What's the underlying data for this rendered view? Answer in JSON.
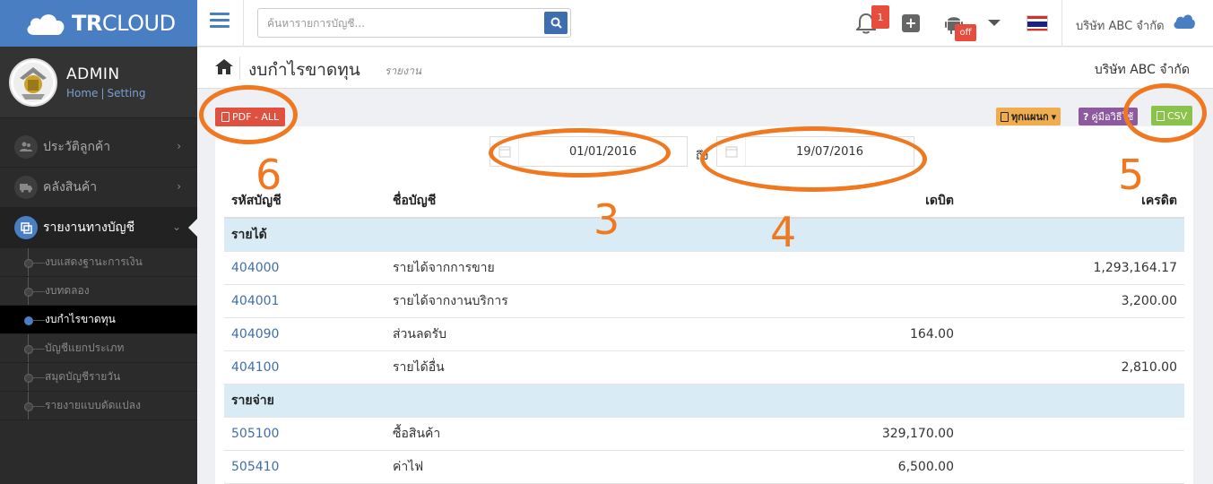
{
  "brand": {
    "name_bold": "TR",
    "name_rest": "CLOUD"
  },
  "user": {
    "name": "ADMIN",
    "link_home": "Home",
    "link_sep": "|",
    "link_setting": "Setting"
  },
  "nav": [
    {
      "label": "ประวัติลูกค้า",
      "icon": "users-icon"
    },
    {
      "label": "คลังสินค้า",
      "icon": "truck-icon"
    },
    {
      "label": "รายงานทางบัญชี",
      "icon": "report-icon"
    }
  ],
  "subnav": [
    {
      "label": "งบแสดงฐานะการเงิน"
    },
    {
      "label": "งบทดลอง"
    },
    {
      "label": "งบกำไรขาดทุน"
    },
    {
      "label": "บัญชีแยกประเภท"
    },
    {
      "label": "สมุดบัญชีรายวัน"
    },
    {
      "label": "รายงายแบบดัดแปลง"
    }
  ],
  "topbar": {
    "search_placeholder": "ค้นหารายการบัญชี...",
    "notification_count": "1",
    "android_badge": "off",
    "company": "บริษัท ABC จำกัด"
  },
  "page": {
    "title": "งบกำไรขาดทุน",
    "subtitle": "รายงาน",
    "company": "บริษัท ABC จำกัด"
  },
  "toolbar": {
    "pdf_label": "PDF - ALL",
    "plan_label": "ทุกแผนก",
    "manual_label": "คู่มือวิธีใช้",
    "csv_label": "CSV"
  },
  "filter": {
    "date_from": "01/01/2016",
    "to_label": "ถึง",
    "date_to": "19/07/2016"
  },
  "table": {
    "headers": {
      "code": "รหัสบัญชี",
      "name": "ชื่อบัญชี",
      "debit": "เดบิต",
      "credit": "เครดิต"
    },
    "groups": [
      {
        "title": "รายได้",
        "rows": [
          {
            "code": "404000",
            "name": "รายได้จากการขาย",
            "debit": "",
            "credit": "1,293,164.17"
          },
          {
            "code": "404001",
            "name": "รายได้จากงานบริการ",
            "debit": "",
            "credit": "3,200.00"
          },
          {
            "code": "404090",
            "name": "ส่วนลดรับ",
            "debit": "164.00",
            "credit": ""
          },
          {
            "code": "404100",
            "name": "รายได้อื่น",
            "debit": "",
            "credit": "2,810.00"
          }
        ]
      },
      {
        "title": "รายจ่าย",
        "rows": [
          {
            "code": "505100",
            "name": "ซื้อสินค้า",
            "debit": "329,170.00",
            "credit": ""
          },
          {
            "code": "505410",
            "name": "ค่าไฟ",
            "debit": "6,500.00",
            "credit": ""
          }
        ]
      }
    ]
  },
  "annotations": {
    "color": "#f07820",
    "labels": [
      "6",
      "3",
      "4",
      "5"
    ]
  },
  "colors": {
    "brand_blue": "#4a7ec2",
    "sidebar_bg": "#2b2b2b",
    "group_row_bg": "#d9ecf5",
    "pdf_red": "#e0503e",
    "csv_green": "#8bc34a",
    "plan_orange": "#f0ad4e",
    "manual_purple": "#8e5a9f"
  }
}
